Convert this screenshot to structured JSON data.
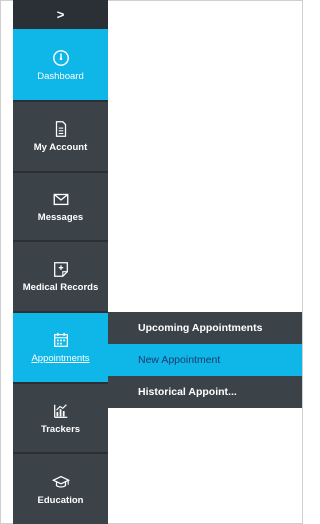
{
  "sidebar": {
    "collapse_glyph": ">",
    "items": [
      {
        "label": "Dashboard",
        "icon": "dashboard-gauge-icon"
      },
      {
        "label": "My Account",
        "icon": "document-icon"
      },
      {
        "label": "Messages",
        "icon": "envelope-icon"
      },
      {
        "label": "Medical Records",
        "icon": "medical-records-icon"
      },
      {
        "label": "Appointments",
        "icon": "calendar-icon"
      },
      {
        "label": "Trackers",
        "icon": "chart-icon"
      },
      {
        "label": "Education",
        "icon": "graduation-cap-icon"
      }
    ]
  },
  "submenu": {
    "items": [
      {
        "label": "Upcoming Appointments"
      },
      {
        "label": "New Appointment"
      },
      {
        "label": "Historical Appoint..."
      }
    ]
  },
  "colors": {
    "accent": "#0fb6e8",
    "sidebar_bg": "#3b4349",
    "selected_text": "#1b3a6b"
  }
}
